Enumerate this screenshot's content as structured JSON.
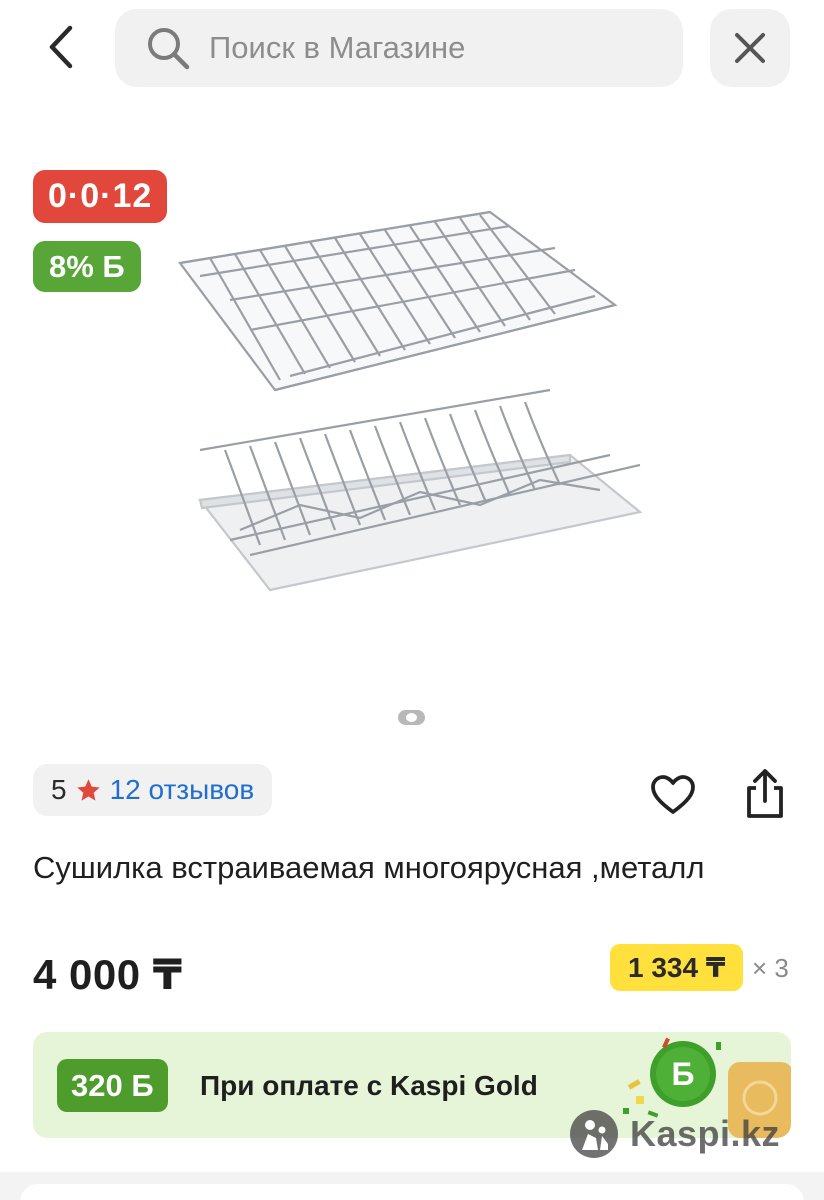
{
  "header": {
    "search_placeholder": "Поиск в Магазине"
  },
  "badges": {
    "installment": "0·0·12",
    "bonus_percent": "8% Б"
  },
  "gallery": {
    "current_page": 1,
    "total_pages": 1
  },
  "rating": {
    "value": "5",
    "reviews_label": "12 отзывов"
  },
  "product": {
    "title": "Сушилка встраиваемая многоярусная ,металл",
    "price": "4 000 ₸",
    "monthly_payment": "1 334 ₸",
    "monthly_multiplier": "× 3"
  },
  "bonus_banner": {
    "amount": "320 Б",
    "text": "При оплате с Kaspi Gold",
    "coin_label": "Б"
  },
  "watermark": {
    "text": "Kaspi.kz"
  },
  "colors": {
    "installment_red": "#e1483b",
    "bonus_green": "#57a637",
    "monthly_yellow": "#ffe03c",
    "link_blue": "#1f6fd0",
    "banner_bg": "#e6f4d8"
  }
}
